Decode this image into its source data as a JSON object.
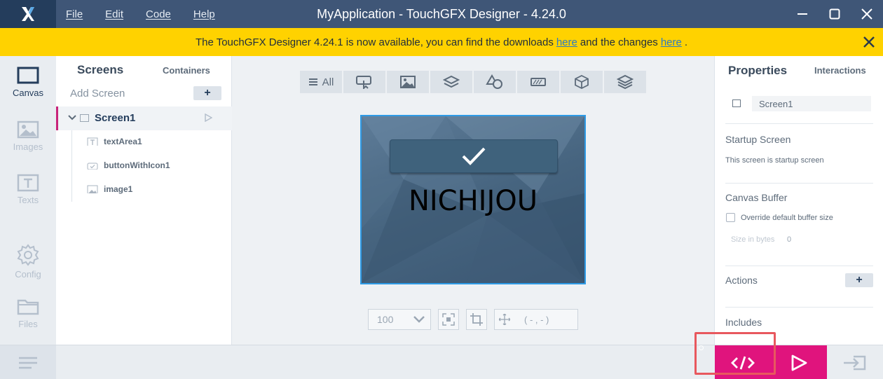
{
  "titlebar": {
    "title": "MyApplication - TouchGFX Designer - 4.24.0",
    "menu": [
      "File",
      "Edit",
      "Code",
      "Help"
    ],
    "logo_icon": "touchgfx-x-logo"
  },
  "banner": {
    "text_before": "The TouchGFX Designer 4.24.1 is now available, you can find the downloads",
    "link1": "here",
    "text_middle": "and the changes",
    "link2": "here",
    "text_after": ".",
    "bg_color": "#ffd200"
  },
  "rail": {
    "canvas": "Canvas",
    "images": "Images",
    "texts": "Texts",
    "config": "Config",
    "files": "Files"
  },
  "screens_panel": {
    "tab_screens": "Screens",
    "tab_containers": "Containers",
    "add_screen": "Add Screen",
    "add_symbol": "+",
    "screen_name": "Screen1",
    "children": [
      "textArea1",
      "buttonWithIcon1",
      "image1"
    ]
  },
  "toolbar": {
    "all_label": "All",
    "icons": [
      "interaction-icon",
      "image-icon",
      "layers-icon",
      "shapes-icon",
      "progress-icon",
      "3d-box-icon",
      "stack-icon"
    ]
  },
  "preview": {
    "text": "NICHIJOU",
    "button_icon": "checkmark-icon"
  },
  "zoom": {
    "value": "100",
    "coords": "( - , - )"
  },
  "properties": {
    "tab_properties": "Properties",
    "tab_interactions": "Interactions",
    "screen_name": "Screen1",
    "startup_title": "Startup Screen",
    "startup_text": "This screen is startup screen",
    "buffer_title": "Canvas Buffer",
    "override_label": "Override default buffer size",
    "size_label": "Size in bytes",
    "size_value": "0",
    "actions_title": "Actions",
    "actions_plus": "+",
    "includes_title": "Includes"
  },
  "colors": {
    "titlebar": "#3f5677",
    "accent_pink": "#e0147d",
    "selection_border": "#2e9be6",
    "highlight_red": "#e8585e"
  }
}
